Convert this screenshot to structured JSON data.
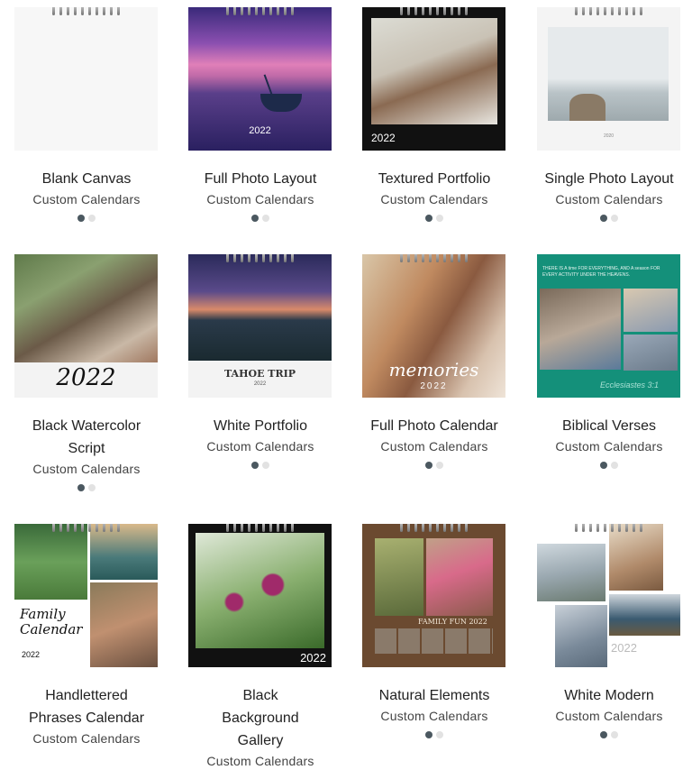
{
  "products": [
    {
      "name": "Blank Canvas",
      "category": "Custom Calendars",
      "cover_text": ""
    },
    {
      "name": "Full Photo Layout",
      "category": "Custom Calendars",
      "cover_text": "2022"
    },
    {
      "name": "Textured Portfolio",
      "category": "Custom Calendars",
      "cover_text": "2022"
    },
    {
      "name": "Single Photo Layout",
      "category": "Custom Calendars",
      "cover_text": "2020"
    },
    {
      "name": "Black Watercolor Script",
      "category": "Custom Calendars",
      "cover_text": "2022"
    },
    {
      "name": "White Portfolio",
      "category": "Custom Calendars",
      "cover_text": "TAHOE TRIP",
      "cover_subtext": "2022"
    },
    {
      "name": "Full Photo Calendar",
      "category": "Custom Calendars",
      "cover_text": "memories",
      "cover_subtext": "2022"
    },
    {
      "name": "Biblical Verses",
      "category": "Custom Calendars",
      "cover_text": "THERE IS A time FOR EVERYTHING, AND A season FOR EVERY ACTIVITY UNDER THE HEAVENS.",
      "cover_subtext": "Ecclesiastes 3:1"
    },
    {
      "name": "Handlettered Phrases Calendar",
      "category": "Custom Calendars",
      "cover_text": "Family Calendar",
      "cover_subtext": "2022"
    },
    {
      "name": "Black Background Gallery",
      "category": "Custom Calendars",
      "cover_text": "2022"
    },
    {
      "name": "Natural Elements",
      "category": "Custom Calendars",
      "cover_text": "FAMILY FUN 2022"
    },
    {
      "name": "White Modern",
      "category": "Custom Calendars",
      "cover_text": "2022"
    }
  ],
  "carousel": {
    "total_images": 2,
    "active_index": 0
  }
}
